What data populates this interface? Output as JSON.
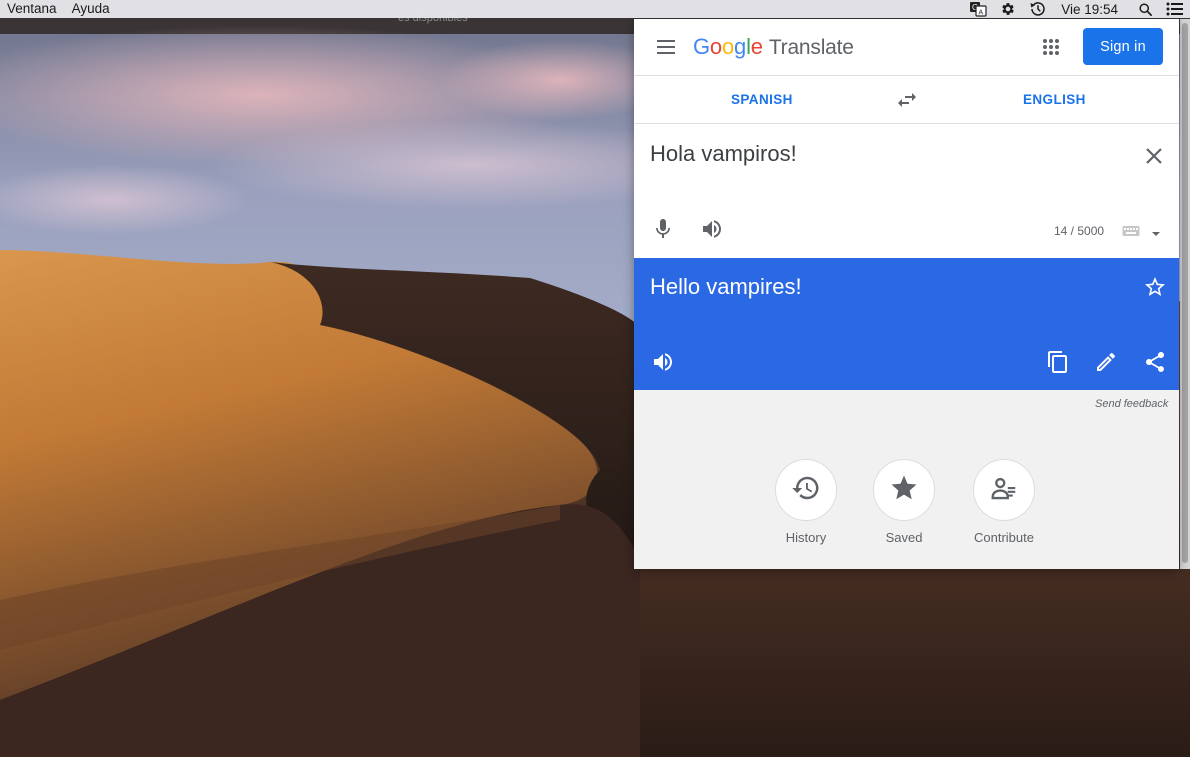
{
  "menubar": {
    "items": [
      "Ventana",
      "Ayuda"
    ],
    "clock": "Vie 19:54",
    "status_icons": [
      "translate-icon",
      "gear-icon",
      "time-machine-icon",
      "spotlight-search-icon",
      "notification-center-icon"
    ]
  },
  "desktop": {
    "ghost_text": "es disponibles"
  },
  "translate": {
    "logo": {
      "letters": [
        "G",
        "o",
        "o",
        "g",
        "l",
        "e"
      ],
      "product": "Translate"
    },
    "sign_in": "Sign in",
    "source_lang": "SPANISH",
    "target_lang": "ENGLISH",
    "source_text": "Hola vampiros!",
    "char_count": "14 / 5000",
    "translated_text": "Hello vampires!",
    "send_feedback": "Send feedback",
    "quick_links": [
      {
        "label": "History",
        "icon": "history-icon"
      },
      {
        "label": "Saved",
        "icon": "star-icon"
      },
      {
        "label": "Contribute",
        "icon": "contribute-icon"
      }
    ]
  },
  "colors": {
    "accent": "#1a73e8",
    "translation_panel": "#2b68e3",
    "panel_background": "#f1f1f1"
  }
}
